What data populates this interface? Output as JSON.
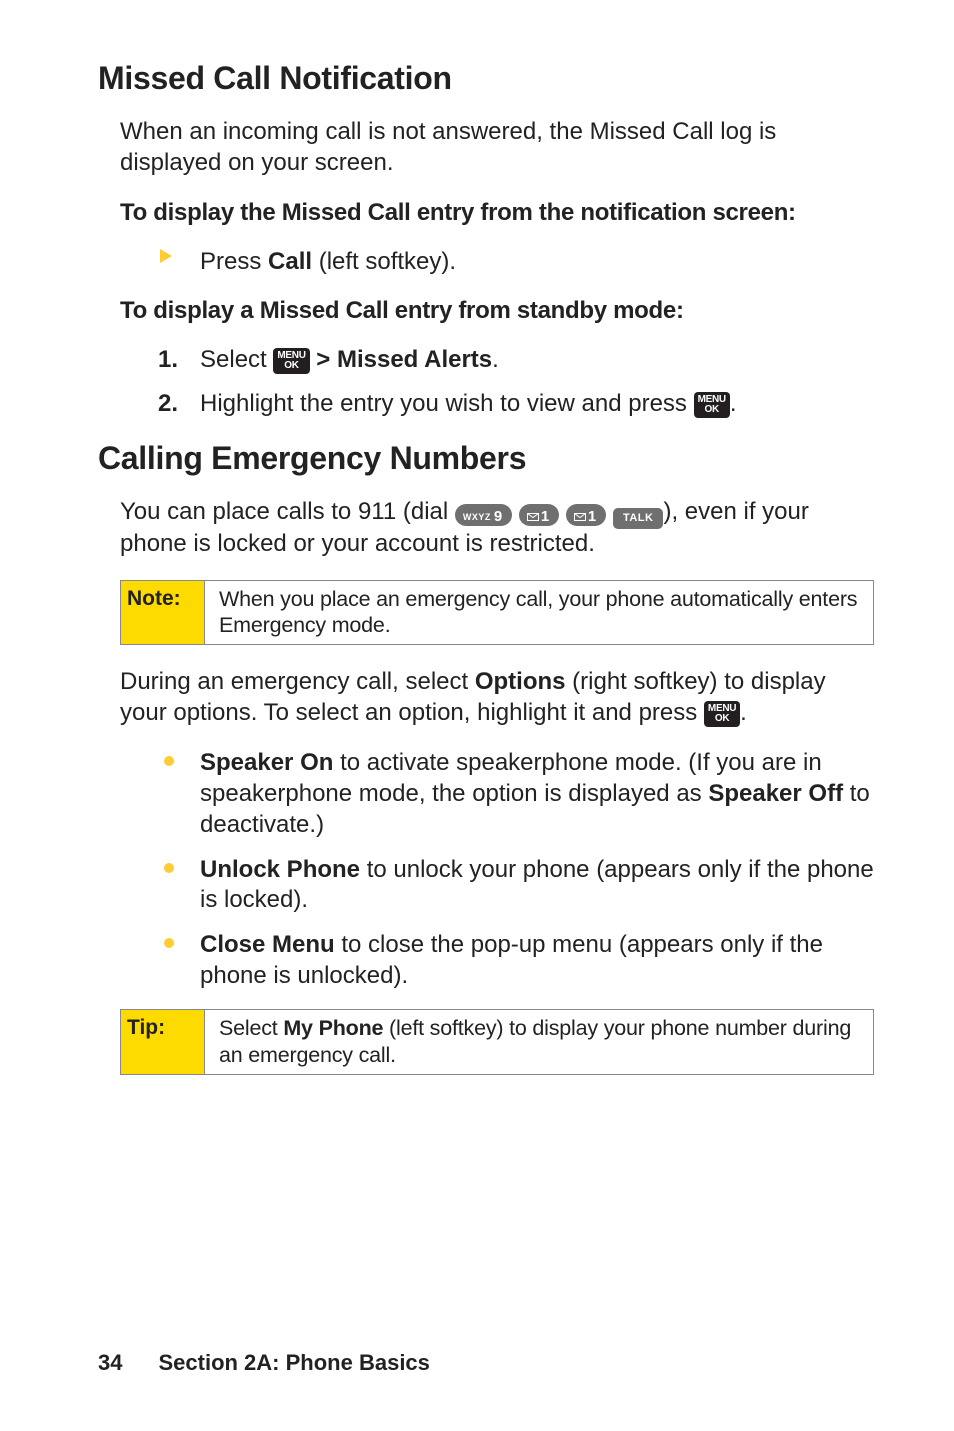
{
  "h1": "Missed Call Notification",
  "p1": "When an incoming call is not answered, the Missed Call log is displayed on your screen.",
  "sub1": "To display the Missed Call entry from the notification screen:",
  "step_call_a": "Press ",
  "step_call_b": "Call",
  "step_call_c": " (left softkey).",
  "sub2": "To display a Missed Call entry from standby mode:",
  "s1_num": "1.",
  "s1_a": "Select ",
  "s1_b": " > Missed Alerts",
  "s1_c": ".",
  "s2_num": "2.",
  "s2_a": "Highlight the entry you wish to view and press ",
  "s2_b": ".",
  "h2": "Calling Emergency Numbers",
  "p2_a": "You can place calls to 911 (dial ",
  "p2_b": "), even if your phone is locked or your account is restricted.",
  "key9_sm": "WXYZ",
  "key9_big": "9",
  "key1_big": "1",
  "key_talk": "TALK",
  "key_menu_t": "MENU",
  "key_menu_b": "OK",
  "note_label": "Note:",
  "note_body": "When you place an emergency call, your phone automatically enters Emergency mode.",
  "p3_a": "During an emergency call, select ",
  "p3_b": "Options",
  "p3_c": " (right softkey) to display your options. To select an option, highlight it and press ",
  "p3_d": ".",
  "b1_t": "Speaker On",
  "b1_r": " to activate speakerphone mode. (If you are in speakerphone mode, the option is displayed as ",
  "b1_t2": "Speaker Off",
  "b1_r2": " to deactivate.)",
  "b2_t": "Unlock Phone",
  "b2_r": " to unlock your phone (appears only if the phone is locked).",
  "b3_t": "Close Menu",
  "b3_r": " to close the pop-up menu (appears only if the phone is unlocked).",
  "tip_label": "Tip:",
  "tip_a": "Select ",
  "tip_b": "My Phone",
  "tip_c": " (left softkey) to display your phone number during an emergency call.",
  "page_num": "34",
  "section": "Section 2A: Phone Basics"
}
